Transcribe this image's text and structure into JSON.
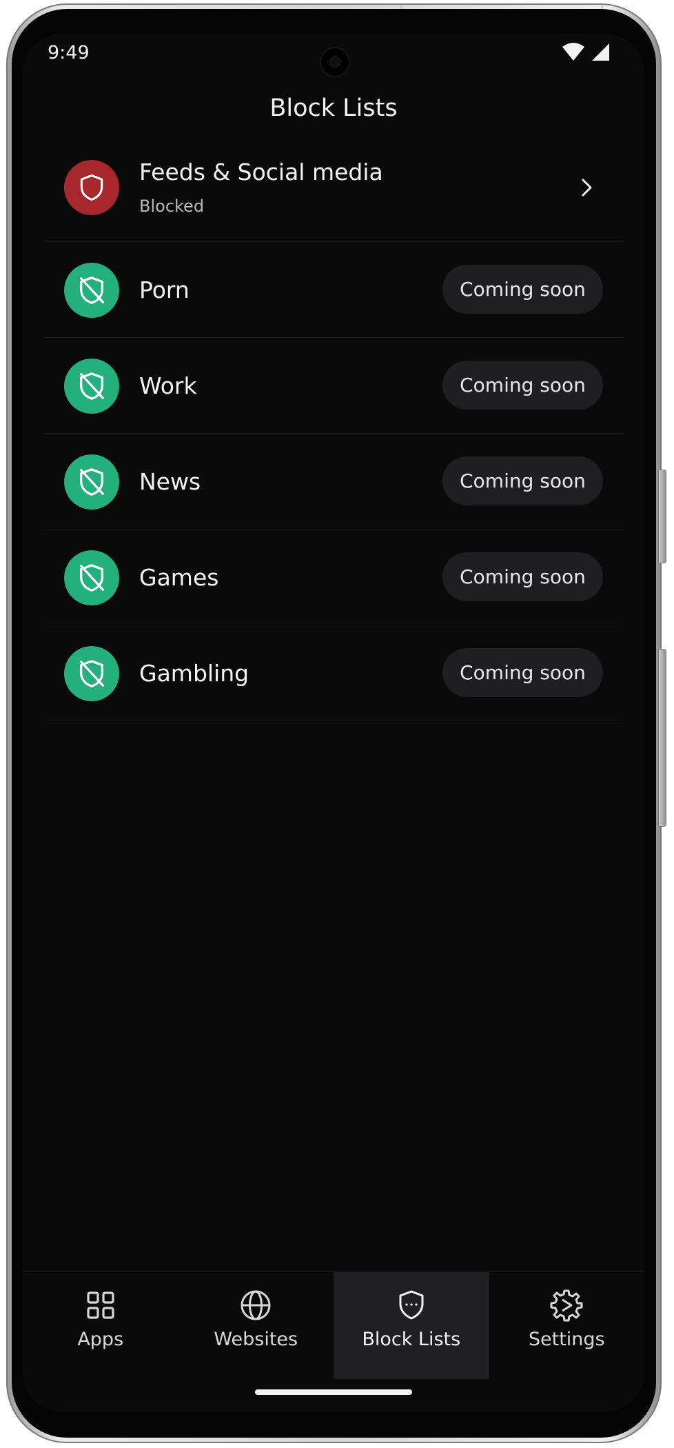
{
  "status_bar": {
    "time": "9:49",
    "icons": [
      "wifi-icon",
      "cellular-signal-icon"
    ]
  },
  "header": {
    "title": "Block Lists"
  },
  "block_lists": [
    {
      "label": "Feeds & Social media",
      "status": "Blocked",
      "icon": "shield-icon",
      "color": "#a8272c"
    },
    {
      "label": "Porn",
      "badge": "Coming soon",
      "icon": "shield-off-icon",
      "color": "#23b07d"
    },
    {
      "label": "Work",
      "badge": "Coming soon",
      "icon": "shield-off-icon",
      "color": "#23b07d"
    },
    {
      "label": "News",
      "badge": "Coming soon",
      "icon": "shield-off-icon",
      "color": "#23b07d"
    },
    {
      "label": "Games",
      "badge": "Coming soon",
      "icon": "shield-off-icon",
      "color": "#23b07d"
    },
    {
      "label": "Gambling",
      "badge": "Coming soon",
      "icon": "shield-off-icon",
      "color": "#23b07d"
    }
  ],
  "bottom_nav": {
    "items": [
      {
        "label": "Apps",
        "icon": "grid-icon"
      },
      {
        "label": "Websites",
        "icon": "globe-icon"
      },
      {
        "label": "Block Lists",
        "icon": "shield-dots-icon",
        "active": true
      },
      {
        "label": "Settings",
        "icon": "gear-icon"
      }
    ]
  },
  "colors": {
    "background": "#0a0a0b",
    "blocked": "#a8272c",
    "available": "#23b07d",
    "pill": "#1f1f21",
    "active_tab": "#202022"
  }
}
